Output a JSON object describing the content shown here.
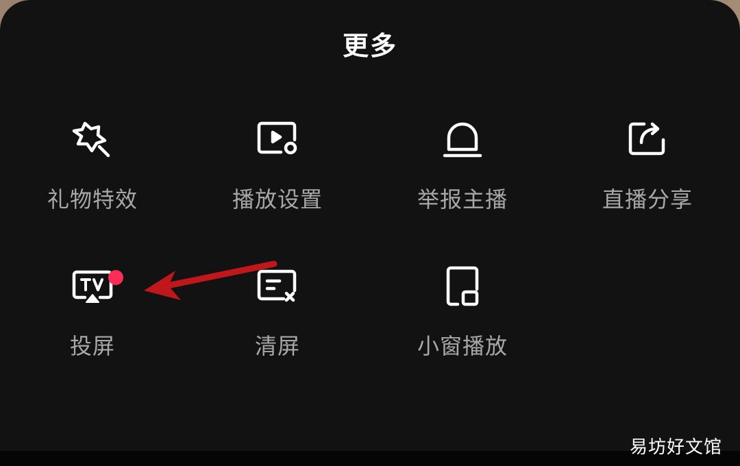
{
  "panel": {
    "title": "更多"
  },
  "grid": {
    "items": [
      {
        "label": "礼物特效",
        "icon": "gift-effect-star-icon"
      },
      {
        "label": "播放设置",
        "icon": "playback-settings-icon"
      },
      {
        "label": "举报主播",
        "icon": "report-alarm-icon"
      },
      {
        "label": "直播分享",
        "icon": "share-icon"
      },
      {
        "label": "投屏",
        "icon": "tv-cast-icon",
        "has_badge": true
      },
      {
        "label": "清屏",
        "icon": "clear-screen-icon"
      },
      {
        "label": "小窗播放",
        "icon": "mini-window-icon"
      }
    ]
  },
  "colors": {
    "panel_bg": "#121212",
    "badge": "#ff2d55",
    "annotation_arrow": "#c0171b"
  },
  "watermark": {
    "text": "易坊好文馆"
  }
}
